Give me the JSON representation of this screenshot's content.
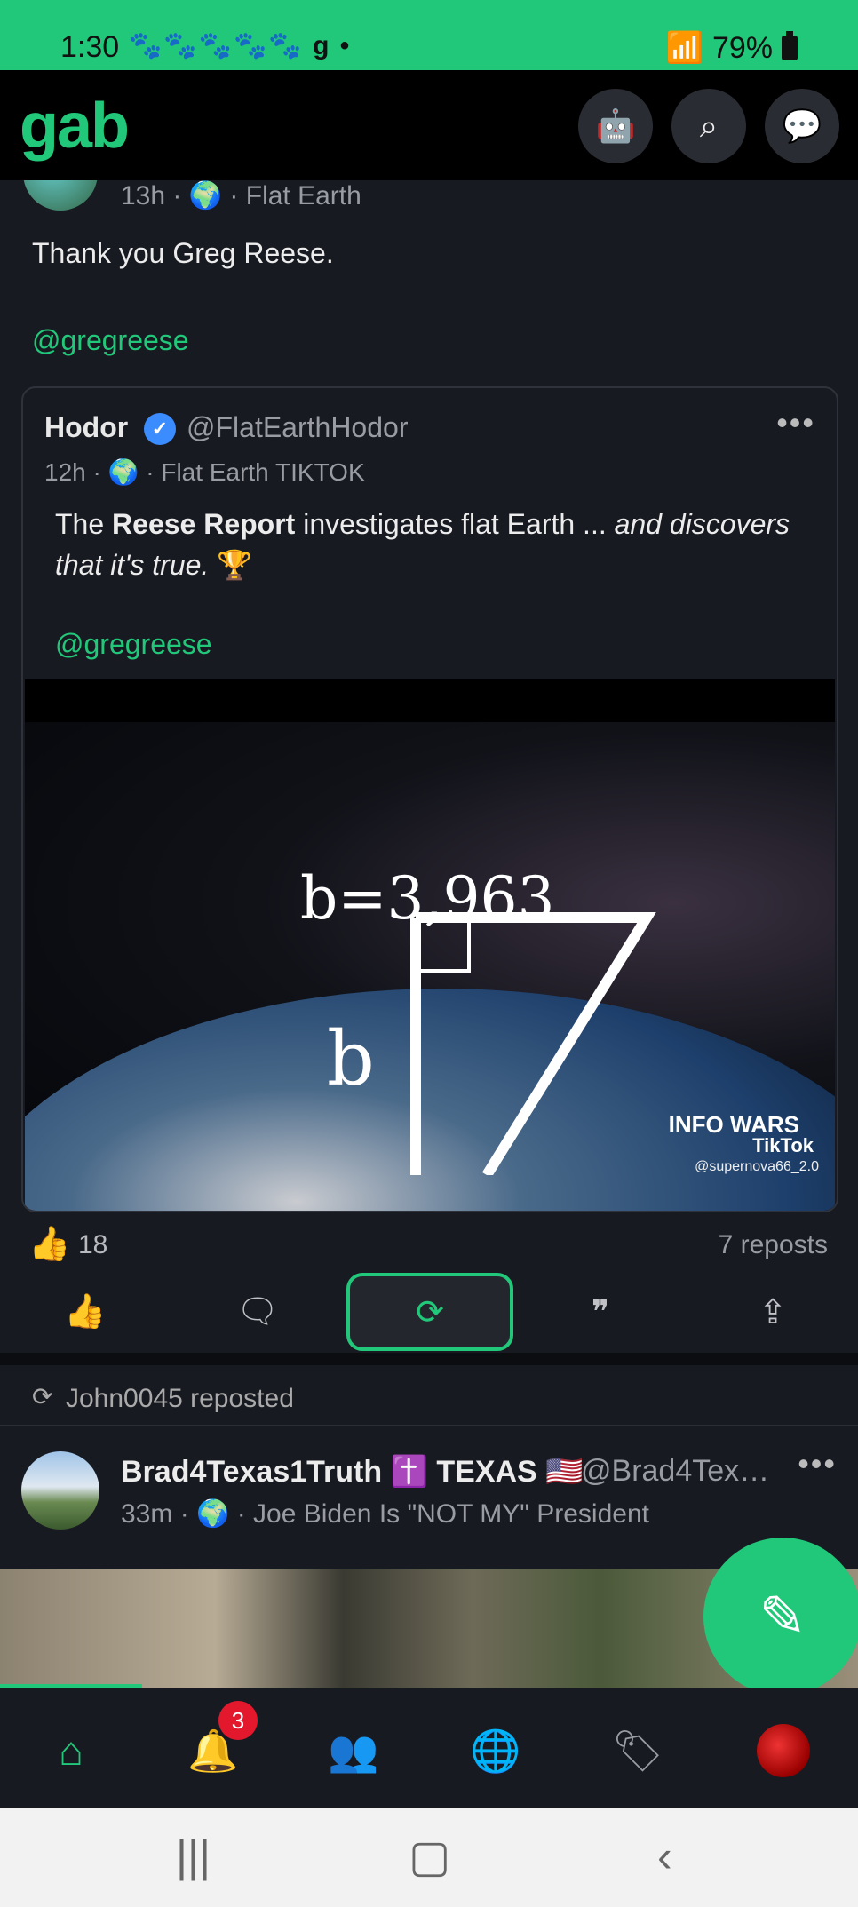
{
  "status_bar": {
    "time": "1:30",
    "notif_icons": "🐾🐾🐾🐾🐾 g •",
    "battery": "79%"
  },
  "header": {
    "logo": "gab",
    "icons": [
      "robot-icon",
      "search-icon",
      "chat-icon"
    ]
  },
  "post": {
    "time": "13h",
    "group": "Flat Earth",
    "text": "Thank you Greg Reese.",
    "mention": "@gregreese",
    "quote": {
      "name": "Hodor",
      "handle": "@FlatEarthHodor",
      "time": "12h",
      "group": "Flat Earth TIKTOK",
      "text_pre": "The ",
      "text_bold": "Reese Report",
      "text_mid": " investigates flat Earth ... ",
      "text_italic": "and discovers that it's true.",
      "text_emoji": " 🏆",
      "mention": "@gregreese",
      "video": {
        "formula": "b=3,963",
        "label": "b",
        "watermark": "INFO WARS",
        "tiktok": "TikTok",
        "tiktok_user": "@supernova66_2.0"
      }
    },
    "like_count": "18",
    "reposts": "7 reposts"
  },
  "reposted_by": "John0045 reposted",
  "post2": {
    "name": "Brad4Texas1Truth ✝️ TEXAS 🇺🇸",
    "handle": "@Brad4Tex…",
    "time": "33m",
    "group": "Joe Biden Is \"NOT MY\" President"
  },
  "bottom_nav": {
    "notification_badge": "3"
  },
  "colors": {
    "accent": "#21c87a",
    "background": "#181a21"
  }
}
